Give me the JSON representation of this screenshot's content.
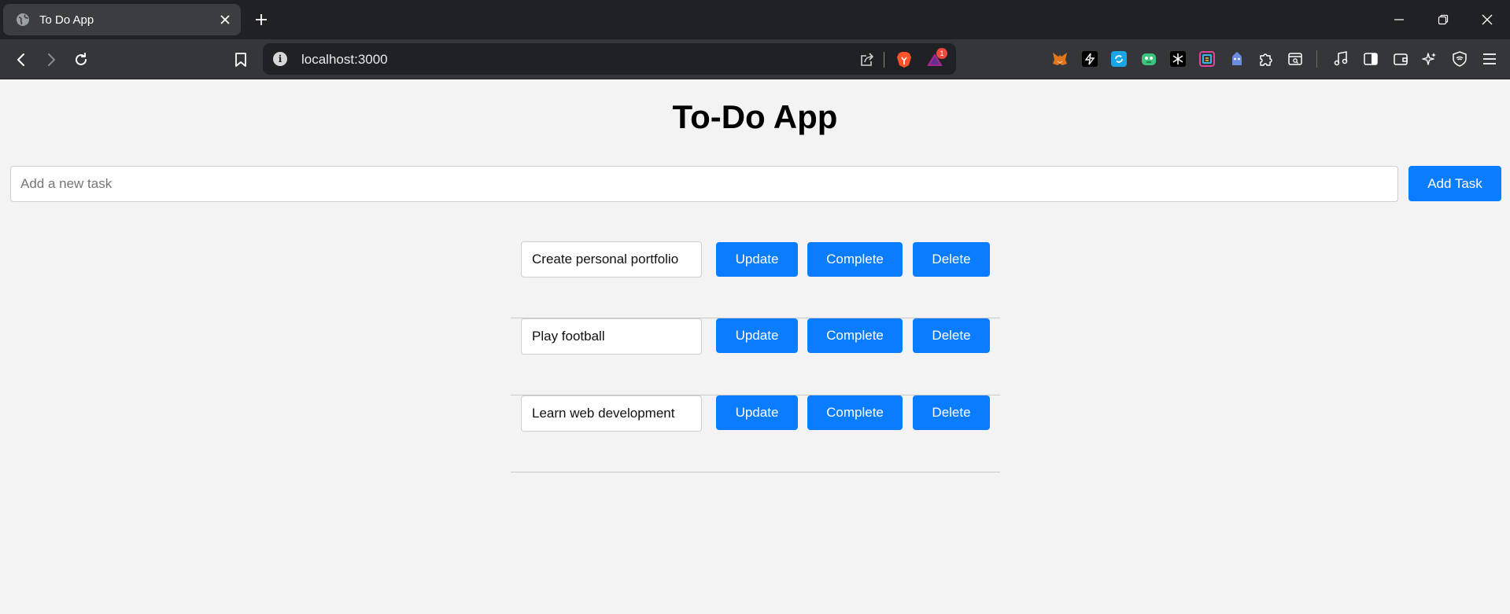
{
  "browser": {
    "tab_title": "To Do App",
    "url": "localhost:3000",
    "notification_badge": "1"
  },
  "app": {
    "title": "To-Do App",
    "new_task_placeholder": "Add a new task",
    "add_button_label": "Add Task",
    "tasks": [
      {
        "text": "Create personal portfolio",
        "update_label": "Update",
        "complete_label": "Complete",
        "delete_label": "Delete"
      },
      {
        "text": "Play football",
        "update_label": "Update",
        "complete_label": "Complete",
        "delete_label": "Delete"
      },
      {
        "text": "Learn web development",
        "update_label": "Update",
        "complete_label": "Complete",
        "delete_label": "Delete"
      }
    ]
  },
  "colors": {
    "accent": "#0a7cff",
    "page_background": "#f3f3f3",
    "chrome_dark": "#202124"
  }
}
